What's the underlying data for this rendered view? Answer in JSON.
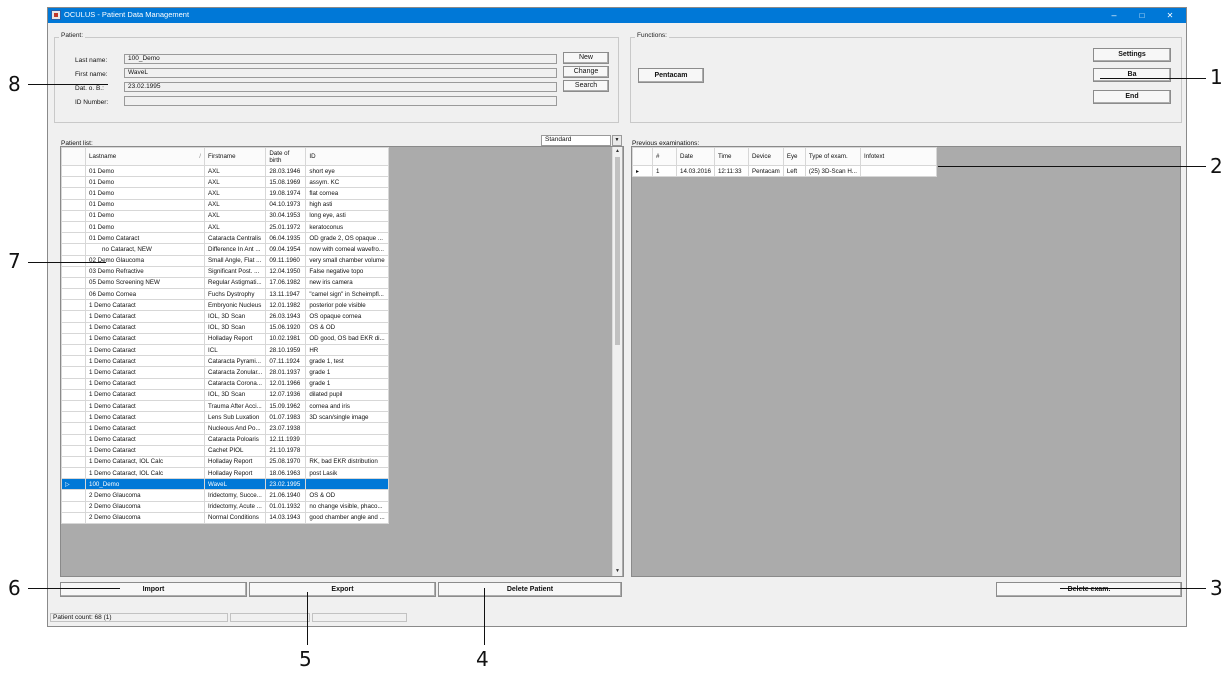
{
  "window": {
    "title": "OCULUS - Patient Data Management",
    "controls": {
      "minimize": "–",
      "maximize": "□",
      "close": "✕"
    }
  },
  "patient_group": {
    "label": "Patient:",
    "last_name_label": "Last name:",
    "last_name": "100_Demo",
    "first_name_label": "First name:",
    "first_name": "WaveL",
    "dob_label": "Dat. o. B.:",
    "dob": "23.02.1995",
    "id_label": "ID Number:",
    "id_value": "",
    "new_button": "New",
    "change_button": "Change",
    "search_button": "Search"
  },
  "functions_group": {
    "label": "Functions:",
    "pentacam_button": "Pentacam",
    "settings_button": "Settings",
    "ba_button": "Ba",
    "end_button": "End"
  },
  "patient_list": {
    "label": "Patient list:",
    "view_select": "Standard",
    "columns": [
      "Lastname",
      "Firstname",
      "Date of birth",
      "ID"
    ],
    "rows": [
      [
        "01 Demo",
        "AXL",
        "28.03.1946",
        "short eye"
      ],
      [
        "01 Demo",
        "AXL",
        "15.08.1969",
        "assym. KC"
      ],
      [
        "01 Demo",
        "AXL",
        "19.08.1974",
        "flat cornea"
      ],
      [
        "01 Demo",
        "AXL",
        "04.10.1973",
        "high asti"
      ],
      [
        "01 Demo",
        "AXL",
        "30.04.1953",
        "long eye, asti"
      ],
      [
        "01 Demo",
        "AXL",
        "25.01.1972",
        "keratoconus"
      ],
      [
        "01 Demo Cataract",
        "Cataracta Centralis",
        "06.04.1935",
        "OD grade 2, OS opaque ..."
      ],
      [
        "no Cataract, NEW",
        "Difference In Ant ...",
        "09.04.1954",
        "now with corneal wavefro..."
      ],
      [
        "02 Demo Glaucoma",
        "Small Angle, Flat ...",
        "09.11.1960",
        "very small chamber volume"
      ],
      [
        "03 Demo Refractive",
        "Significant Post. ...",
        "12.04.1950",
        "False negative topo"
      ],
      [
        "05 Demo Screening NEW",
        "Regular Astigmati...",
        "17.06.1982",
        "new iris camera"
      ],
      [
        "06 Demo Cornea",
        "Fuchs Dystrophy",
        "13.11.1947",
        "\"camel sign\" in Scheimpfl..."
      ],
      [
        "1 Demo Cataract",
        "Embryonic Nucleus",
        "12.01.1982",
        "posterior pole visible"
      ],
      [
        "1 Demo Cataract",
        "IOL, 3D Scan",
        "26.03.1943",
        "OS opaque cornea"
      ],
      [
        "1 Demo Cataract",
        "IOL, 3D Scan",
        "15.06.1920",
        "OS & OD"
      ],
      [
        "1 Demo Cataract",
        "Holladay Report",
        "10.02.1981",
        "OD good, OS bad EKR di..."
      ],
      [
        "1 Demo Cataract",
        "ICL",
        "28.10.1959",
        "HR"
      ],
      [
        "1 Demo Cataract",
        "Cataracta Pyrami...",
        "07.11.1924",
        "grade 1, test"
      ],
      [
        "1 Demo Cataract",
        "Cataracta Zonular...",
        "28.01.1937",
        "grade 1"
      ],
      [
        "1 Demo Cataract",
        "Cataracta Corona...",
        "12.01.1966",
        "grade 1"
      ],
      [
        "1 Demo Cataract",
        "IOL, 3D Scan",
        "12.07.1936",
        "dilated pupil"
      ],
      [
        "1 Demo Cataract",
        "Trauma After Acci...",
        "15.09.1962",
        "cornea and iris"
      ],
      [
        "1 Demo Cataract",
        "Lens Sub Luxation",
        "01.07.1983",
        "3D scan/single image"
      ],
      [
        "1 Demo Cataract",
        "Nucleous And Po...",
        "23.07.1938",
        ""
      ],
      [
        "1 Demo Cataract",
        "Cataracta Poloaris",
        "12.11.1939",
        ""
      ],
      [
        "1 Demo Cataract",
        "Cachet PIOL",
        "21.10.1978",
        ""
      ],
      [
        "1 Demo Cataract, IOL Calc",
        "Holladay Report",
        "25.08.1970",
        "RK, bad EKR distribution"
      ],
      [
        "1 Demo Cataract, IOL Calc",
        "Holladay Report",
        "18.06.1963",
        "post Lasik"
      ],
      [
        "100_Demo",
        "WaveL",
        "23.02.1995",
        ""
      ],
      [
        "2 Demo Glaucoma",
        "Iridectomy, Succe...",
        "21.06.1940",
        "OS & OD"
      ],
      [
        "2 Demo Glaucoma",
        "Iridectomy, Acute ...",
        "01.01.1932",
        "no change visible,  phaco..."
      ],
      [
        "2 Demo Glaucoma",
        "Normal Conditions",
        "14.03.1943",
        "good chamber angle and ..."
      ]
    ],
    "selected_row": 28
  },
  "previous_exams": {
    "label": "Previous examinations:",
    "columns": [
      "#",
      "Date",
      "Time",
      "Device",
      "Eye",
      "Type of exam.",
      "Infotext"
    ],
    "rows": [
      [
        "1",
        "14.03.2016",
        "12:11:33",
        "Pentacam",
        "Left",
        "(25) 3D-Scan H...",
        ""
      ]
    ]
  },
  "bottom_buttons": {
    "import": "Import",
    "export": "Export",
    "delete_patient": "Delete Patient",
    "delete_exam": "Delete exam."
  },
  "status_bar": {
    "patient_count": "Patient count: 68 (1)"
  },
  "callouts": [
    "1",
    "2",
    "3",
    "4",
    "5",
    "6",
    "7",
    "8"
  ]
}
